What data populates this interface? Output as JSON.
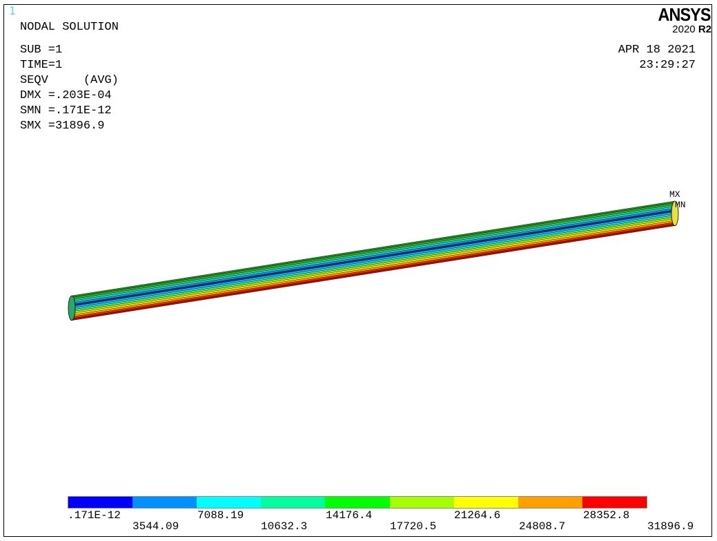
{
  "window_number": "1",
  "title": "NODAL SOLUTION",
  "info_lines": [
    "SUB =1",
    "TIME=1",
    "SEQV     (AVG)",
    "DMX =.203E-04",
    "SMN =.171E-12",
    "SMX =31896.9"
  ],
  "date": "APR 18 2021",
  "time": "23:29:27",
  "logo": {
    "brand": "ANSYS",
    "version": "2020",
    "release": "R2"
  },
  "markers": {
    "max": "MX",
    "min": "MN"
  },
  "legend": {
    "colors": [
      "#0000ff",
      "#0091ff",
      "#00ffff",
      "#00ffa0",
      "#00ff00",
      "#a6ff00",
      "#ffff00",
      "#ffa000",
      "#ff0000"
    ],
    "labels_top": [
      ".171E-12",
      "7088.19",
      "14176.4",
      "21264.6",
      "28352.8"
    ],
    "labels_bottom": [
      "3544.09",
      "10632.3",
      "17720.5",
      "24808.7",
      "31896.9"
    ]
  },
  "model_bands": [
    "#1f8a1f",
    "#2bb62b",
    "#34d07a",
    "#24d4d8",
    "#0c9ae0",
    "#1c2d8a",
    "#20b0e8",
    "#22dcdc",
    "#4ef08a",
    "#b8f000",
    "#ffe800",
    "#ffa800",
    "#ff2a00",
    "#a81010"
  ]
}
